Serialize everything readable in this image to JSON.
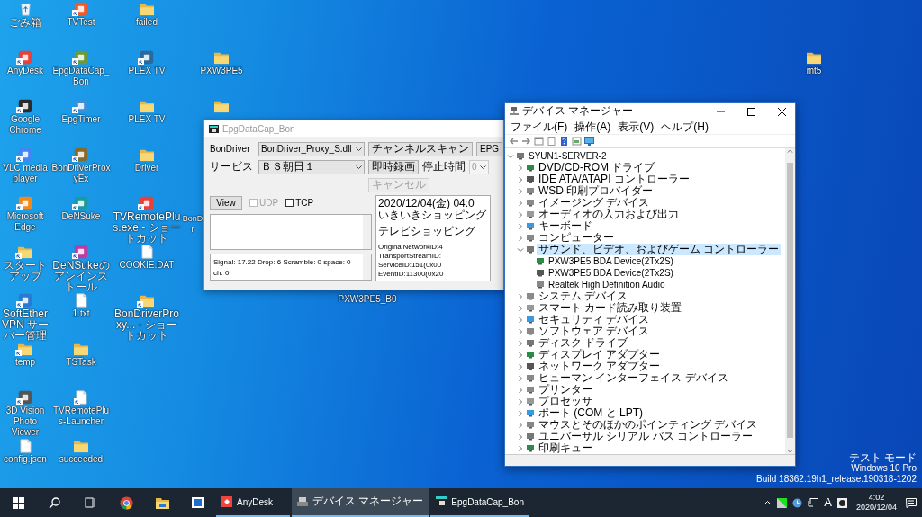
{
  "desktop": {
    "columns": [
      [
        {
          "label": "ごみ箱",
          "kind": "recycle",
          "shortcut": false
        },
        {
          "label": "AnyDesk",
          "kind": "app",
          "shortcut": true
        },
        {
          "label": "Google Chrome",
          "kind": "app",
          "shortcut": true
        },
        {
          "label": "VLC media player",
          "kind": "app",
          "shortcut": true
        },
        {
          "label": "Microsoft Edge",
          "kind": "app",
          "shortcut": true
        },
        {
          "label": "スタートアップ",
          "kind": "folder",
          "shortcut": true
        },
        {
          "label": "SoftEther VPN サーバー管理",
          "kind": "app",
          "shortcut": true
        },
        {
          "label": "temp",
          "kind": "folder",
          "shortcut": true
        },
        {
          "label": "3D Vision Photo Viewer",
          "kind": "app",
          "shortcut": true
        },
        {
          "label": "config.json",
          "kind": "document",
          "shortcut": false
        }
      ],
      [
        {
          "label": "TVTest",
          "kind": "app",
          "shortcut": true
        },
        {
          "label": "EpgDataCap_Bon",
          "kind": "app",
          "shortcut": true
        },
        {
          "label": "EpgTimer",
          "kind": "app",
          "shortcut": true
        },
        {
          "label": "BonDriverProxyEx",
          "kind": "app",
          "shortcut": true
        },
        {
          "label": "DeNSuke",
          "kind": "app",
          "shortcut": true
        },
        {
          "label": "DeNSukeのアンインストール",
          "kind": "app",
          "shortcut": true
        },
        {
          "label": "1.txt",
          "kind": "document",
          "shortcut": false
        },
        {
          "label": "TSTask",
          "kind": "folder",
          "shortcut": false
        },
        {
          "label": "TVRemotePlus-Launcher",
          "kind": "document",
          "shortcut": true
        },
        {
          "label": "succeeded",
          "kind": "folder",
          "shortcut": false
        }
      ],
      [
        {
          "label": "failed",
          "kind": "folder",
          "shortcut": false
        },
        {
          "label": "PLEX TV",
          "kind": "app",
          "shortcut": true
        },
        {
          "label": "PLEX TV",
          "kind": "folder",
          "shortcut": false
        },
        {
          "label": "Driver",
          "kind": "folder",
          "shortcut": false
        },
        {
          "label": "TVRemotePlus.exe - ショートカット",
          "kind": "app",
          "shortcut": true
        },
        {
          "label": "COOKIE.DAT",
          "kind": "document",
          "shortcut": false
        },
        {
          "label": "BonDriverProxy... - ショートカット",
          "kind": "folder",
          "shortcut": true
        }
      ]
    ],
    "loose": [
      {
        "label": "PXW3PE5",
        "kind": "folder",
        "shortcut": false
      },
      {
        "kind": "folder",
        "shortcut": false
      },
      {
        "label": "BonDr"
      },
      {
        "label": "PXW3PE5_B0"
      },
      {
        "label": "mt5",
        "kind": "folder",
        "shortcut": false
      }
    ]
  },
  "epg_window": {
    "title": "EpgDataCap_Bon",
    "bondriver": {
      "label": "BonDriver",
      "value": "BonDriver_Proxy_S.dll",
      "button": "チャンネルスキャン",
      "epg_button": "EPG"
    },
    "service": {
      "label": "サービス",
      "value": "ＢＳ朝日１",
      "button": "即時録画",
      "stop_label": "停止時間",
      "stop_value": "0",
      "stop_disabled": true
    },
    "cancel": {
      "label": "キャンセル",
      "disabled": true
    },
    "view_button": "View",
    "checkboxes": [
      {
        "label": "UDP",
        "checked": false,
        "disabled": true
      },
      {
        "label": "TCP",
        "checked": false,
        "disabled": false
      }
    ],
    "status": "Signal: 17.22 Drop: 6 Scramble: 0  space: 0 ch: 0",
    "info": [
      [
        "2020/12/04(金) 04:0",
        "いきいきショッピング"
      ],
      [
        "テレビショッピング"
      ],
      [
        "OriginalNetworkID:4",
        "TransportStreamID:",
        "ServiceID:151(0x00",
        "EventID:11300(0x20"
      ]
    ]
  },
  "device_manager": {
    "title": "デバイス マネージャー",
    "menu": [
      "ファイル(F)",
      "操作(A)",
      "表示(V)",
      "ヘルプ(H)"
    ],
    "tree": {
      "label": "SYUN1-SERVER-2",
      "expanded": true,
      "selected": false,
      "children": [
        {
          "label": "DVD/CD-ROM ドライブ",
          "expanded": false,
          "selected": false
        },
        {
          "label": "IDE ATA/ATAPI コントローラー",
          "expanded": false,
          "selected": false
        },
        {
          "label": "WSD 印刷プロバイダー",
          "expanded": false,
          "selected": false
        },
        {
          "label": "イメージング デバイス",
          "expanded": false,
          "selected": false
        },
        {
          "label": "オーディオの入力および出力",
          "expanded": false,
          "selected": false
        },
        {
          "label": "キーボード",
          "expanded": false,
          "selected": false
        },
        {
          "label": "コンピューター",
          "expanded": false,
          "selected": false
        },
        {
          "label": "サウンド、ビデオ、およびゲーム コントローラー",
          "expanded": true,
          "selected": true,
          "children": [
            {
              "label": "PXW3PE5 BDA Device(2Tx2S)",
              "selected": false
            },
            {
              "label": "PXW3PE5 BDA Device(2Tx2S)",
              "selected": false
            },
            {
              "label": "Realtek High Definition Audio",
              "selected": false
            }
          ]
        },
        {
          "label": "システム デバイス",
          "expanded": false,
          "selected": false
        },
        {
          "label": "スマート カード読み取り装置",
          "expanded": false,
          "selected": false
        },
        {
          "label": "セキュリティ デバイス",
          "expanded": false,
          "selected": false
        },
        {
          "label": "ソフトウェア デバイス",
          "expanded": false,
          "selected": false
        },
        {
          "label": "ディスク ドライブ",
          "expanded": false,
          "selected": false
        },
        {
          "label": "ディスプレイ アダプター",
          "expanded": false,
          "selected": false
        },
        {
          "label": "ネットワーク アダプター",
          "expanded": false,
          "selected": false
        },
        {
          "label": "ヒューマン インターフェイス デバイス",
          "expanded": false,
          "selected": false
        },
        {
          "label": "プリンター",
          "expanded": false,
          "selected": false
        },
        {
          "label": "プロセッサ",
          "expanded": false,
          "selected": false
        },
        {
          "label": "ポート (COM と LPT)",
          "expanded": false,
          "selected": false
        },
        {
          "label": "マウスとそのほかのポインティング デバイス",
          "expanded": false,
          "selected": false
        },
        {
          "label": "ユニバーサル シリアル バス コントローラー",
          "expanded": false,
          "selected": false
        },
        {
          "label": "印刷キュー",
          "expanded": false,
          "selected": false
        }
      ]
    }
  },
  "watermark": [
    "テスト モード",
    "Windows 10 Pro",
    "Build 18362.19h1_release.190318-1202"
  ],
  "taskbar": {
    "apps": [
      {
        "label": "AnyDesk",
        "selected": false
      },
      {
        "label": "デバイス マネージャー",
        "selected": true
      },
      {
        "label": "EpgDataCap_Bon",
        "selected": false
      }
    ],
    "ime": "A",
    "time": "4:02",
    "date": "2020/12/04"
  }
}
